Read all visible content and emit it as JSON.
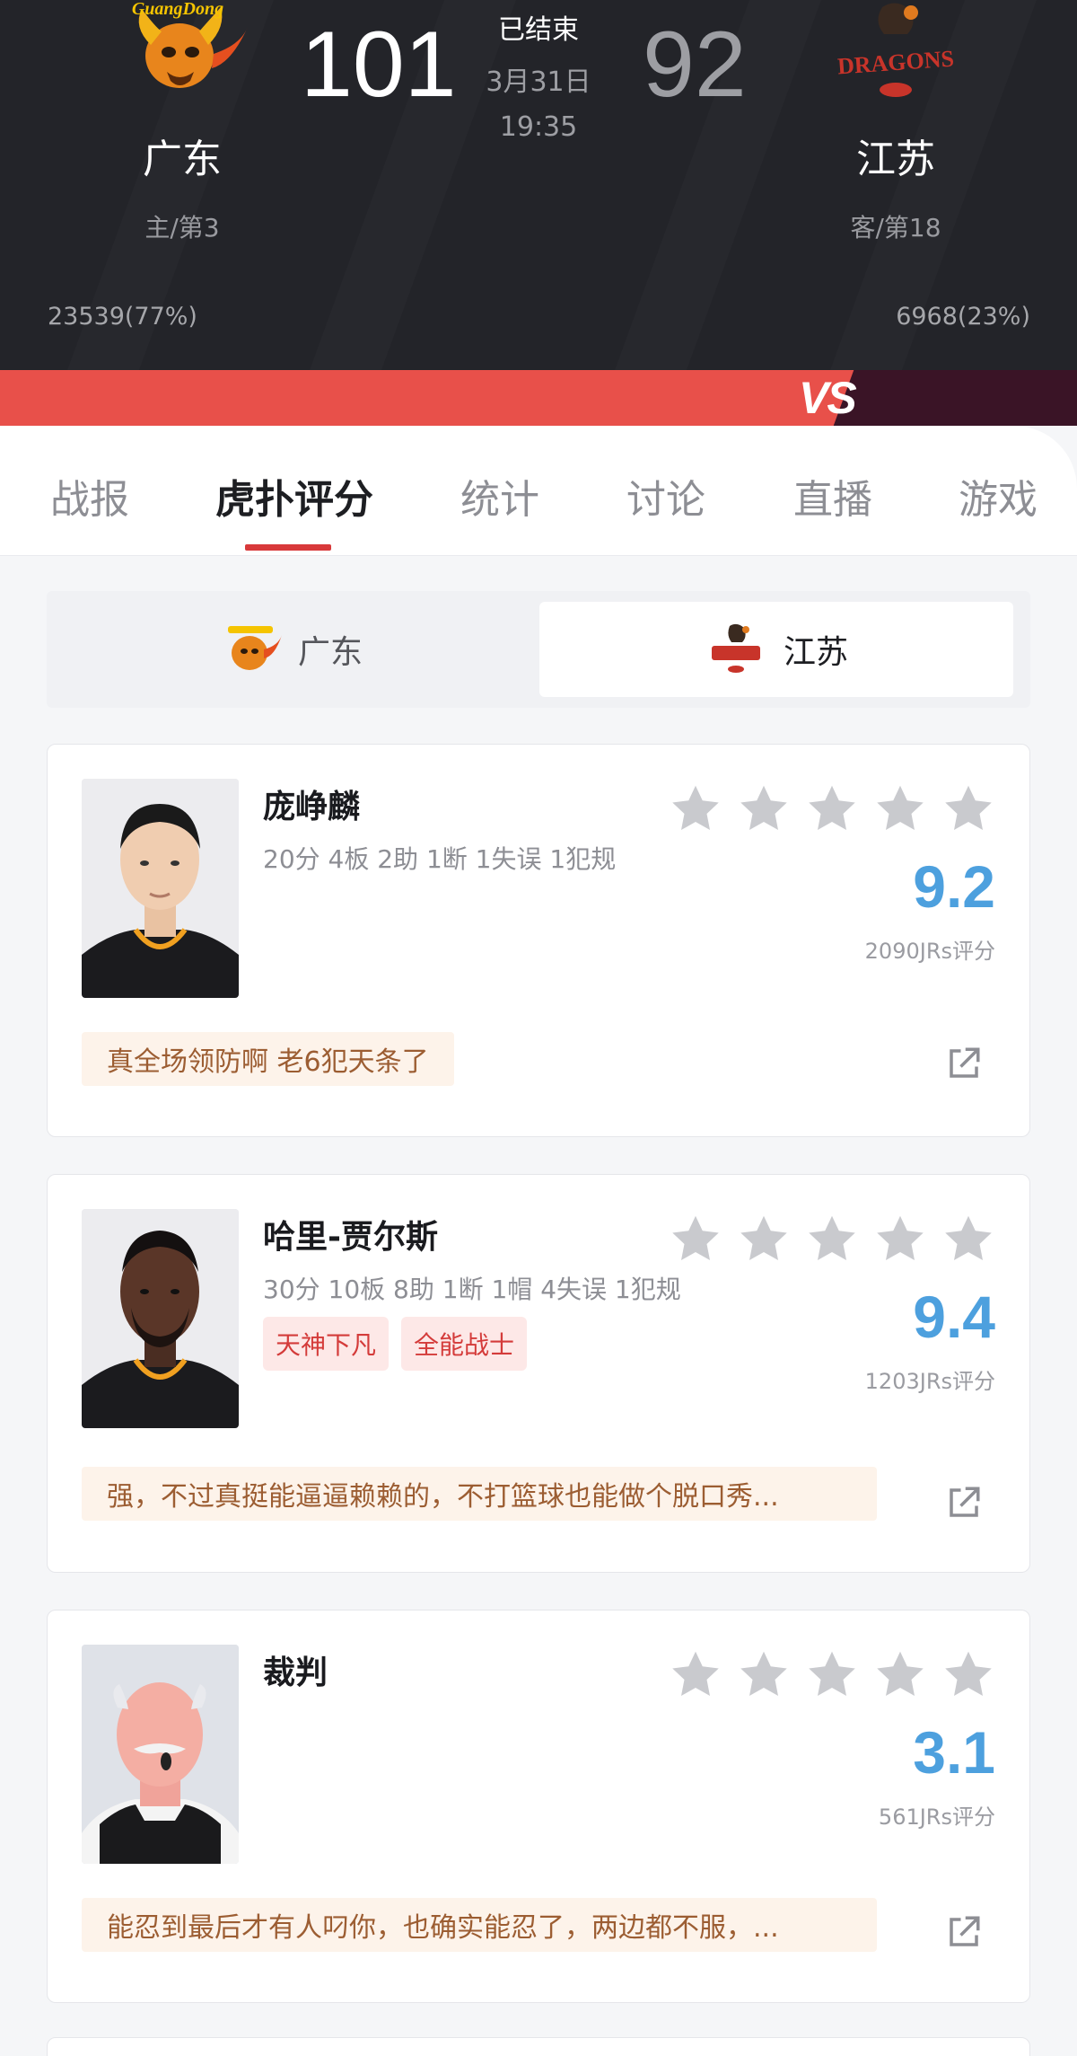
{
  "match": {
    "home": {
      "name": "广东",
      "rank": "主/第3",
      "score": "101",
      "support": "23539(77%)",
      "logo_text": "GuangDong"
    },
    "away": {
      "name": "江苏",
      "rank": "客/第18",
      "score": "92",
      "support": "6968(23%)",
      "logo_text": "DRAGONS"
    },
    "status": "已结束",
    "date": "3月31日",
    "time": "19:35",
    "vs": "VS"
  },
  "tabs": [
    "战报",
    "虎扑评分",
    "统计",
    "讨论",
    "直播",
    "游戏"
  ],
  "active_tab": "虎扑评分",
  "team_toggle": {
    "left": "广东",
    "right": "江苏",
    "selected": "江苏"
  },
  "players": [
    {
      "name": "庞峥麟",
      "stats": "20分 4板 2助 1断 1失误 1犯规",
      "tags": [],
      "rating": "9.2",
      "votes": "2090JRs评分",
      "comment": "真全场领防啊 老6犯天条了",
      "stars": 5
    },
    {
      "name": "哈里-贾尔斯",
      "stats": "30分 10板 8助 1断 1帽 4失误 1犯规",
      "tags": [
        "天神下凡",
        "全能战士"
      ],
      "rating": "9.4",
      "votes": "1203JRs评分",
      "comment": "强，不过真挺能逼逼赖赖的，不打篮球也能做个脱口秀...",
      "stars": 5
    },
    {
      "name": "裁判",
      "stats": "",
      "tags": [],
      "rating": "3.1",
      "votes": "561JRs评分",
      "comment": "能忍到最后才有人叼你，也确实能忍了，两边都不服，...",
      "stars": 5
    }
  ],
  "colors": {
    "header_bg": "#232429",
    "accent_red": "#e8504a",
    "rating_blue": "#4da0de",
    "tag_red": "#d43b3a",
    "comment_brown": "#9c5d32"
  }
}
